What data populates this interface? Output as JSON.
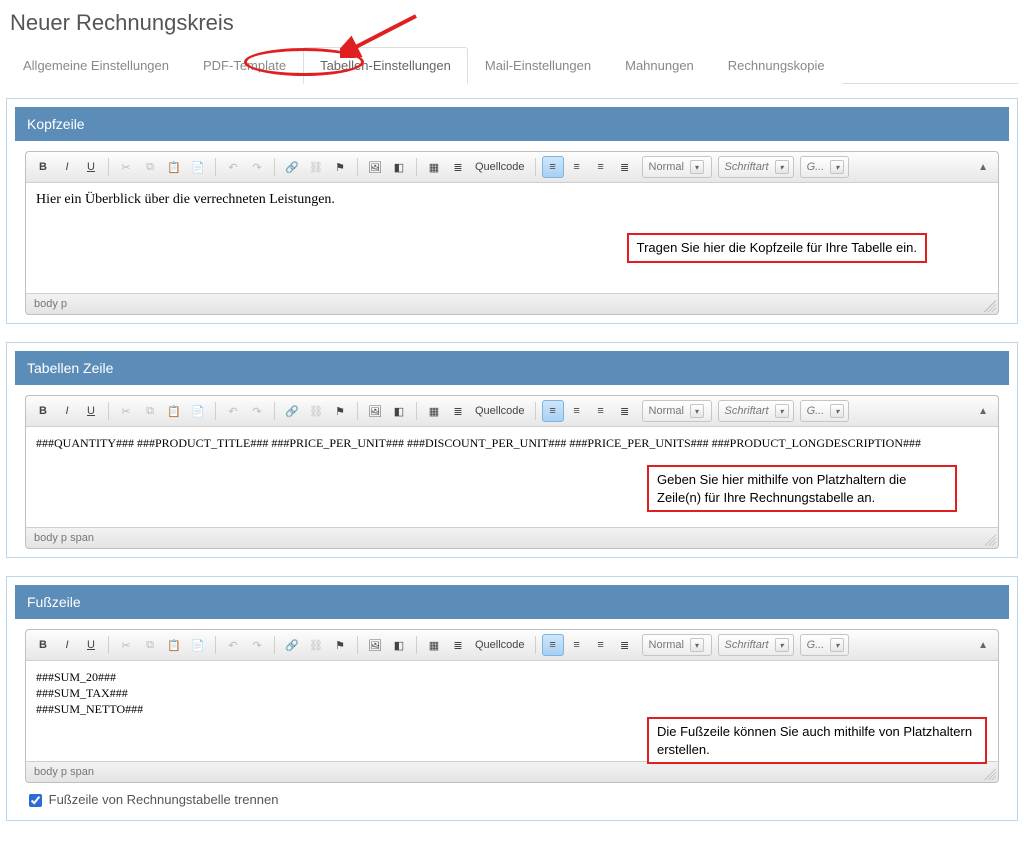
{
  "page": {
    "title": "Neuer Rechnungskreis"
  },
  "tabs": [
    {
      "label": "Allgemeine Einstellungen"
    },
    {
      "label": "PDF-Template"
    },
    {
      "label": "Tabellen-Einstellungen"
    },
    {
      "label": "Mail-Einstellungen"
    },
    {
      "label": "Mahnungen"
    },
    {
      "label": "Rechnungskopie"
    }
  ],
  "active_tab_index": 2,
  "toolbar": {
    "source_label": "Quellcode",
    "format_select": "Normal",
    "font_select": "Schriftart",
    "size_select": "G..."
  },
  "panels": {
    "kopf": {
      "title": "Kopfzeile",
      "content": "Hier ein Überblick über die verrechneten Leistungen.",
      "status": "body   p",
      "annotation": "Tragen Sie hier die Kopfzeile für Ihre Tabelle ein."
    },
    "zeile": {
      "title": "Tabellen Zeile",
      "content": "###QUANTITY### ###PRODUCT_TITLE### ###PRICE_PER_UNIT### ###DISCOUNT_PER_UNIT### ###PRICE_PER_UNITS### ###PRODUCT_LONGDESCRIPTION###",
      "status": "body   p   span",
      "annotation": "Geben Sie hier mithilfe von Platzhaltern die Zeile(n) für Ihre Rechnungstabelle an."
    },
    "fuss": {
      "title": "Fußzeile",
      "content": "###SUM_20###\n###SUM_TAX###\n###SUM_NETTO###",
      "status": "body   p   span",
      "annotation": "Die Fußzeile können Sie auch mithilfe von Platzhaltern erstellen."
    }
  },
  "checkbox": {
    "label": "Fußzeile von Rechnungstabelle trennen",
    "checked": true
  }
}
